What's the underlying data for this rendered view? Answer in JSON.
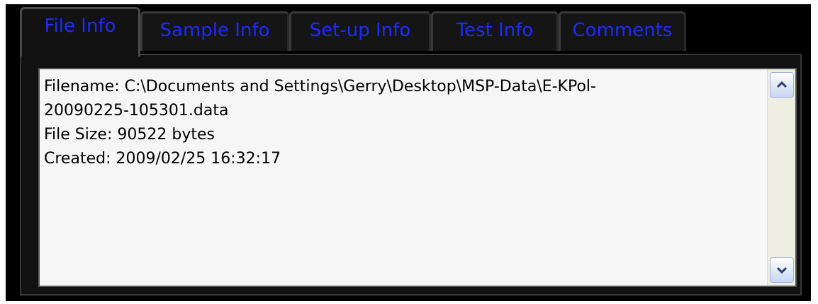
{
  "tabs": [
    {
      "label": "File Info",
      "active": true
    },
    {
      "label": "Sample Info",
      "active": false
    },
    {
      "label": "Set-up Info",
      "active": false
    },
    {
      "label": "Test Info",
      "active": false
    },
    {
      "label": "Comments",
      "active": false
    }
  ],
  "file_info": {
    "lines": [
      "Filename: C:\\Documents and Settings\\Gerry\\Desktop\\MSP-Data\\E-KPol-",
      "20090225-105301.data",
      "File Size: 90522 bytes",
      "Created: 2009/02/25 16:32:17"
    ]
  },
  "scrollbar": {
    "up_icon": "chevron-up-icon",
    "down_icon": "chevron-down-icon"
  },
  "colors": {
    "tab_text": "#1c2cff",
    "background": "#000000",
    "textbox": "#f6f6f6"
  }
}
